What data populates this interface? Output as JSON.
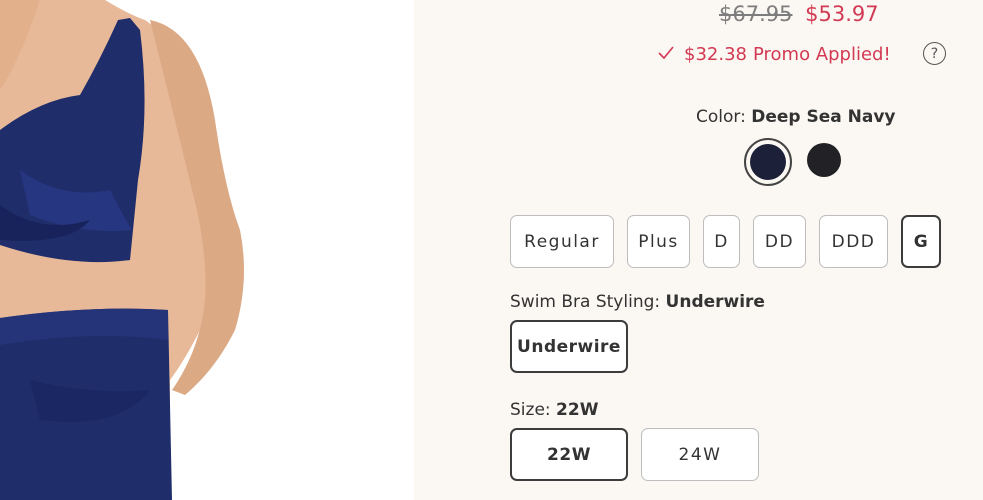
{
  "colors": {
    "accent": "#d23a53",
    "swatch_deep_sea_navy": "#1c2038",
    "swatch_black": "#222226"
  },
  "price": {
    "original": "$67.95",
    "sale": "$53.97"
  },
  "promo": {
    "icon": "check-icon",
    "amount": "$32.38",
    "text": "Promo Applied!",
    "help_symbol": "?"
  },
  "color": {
    "label": "Color:",
    "selected": "Deep Sea Navy",
    "swatches": [
      "Deep Sea Navy",
      "Black"
    ]
  },
  "fit": {
    "options": [
      "Regular",
      "Plus",
      "D",
      "DD",
      "DDD",
      "G"
    ],
    "selected": "G"
  },
  "styling": {
    "label": "Swim Bra Styling:",
    "selected": "Underwire",
    "options": [
      "Underwire"
    ]
  },
  "size": {
    "label": "Size:",
    "selected": "22W",
    "options": [
      "22W",
      "24W"
    ]
  }
}
